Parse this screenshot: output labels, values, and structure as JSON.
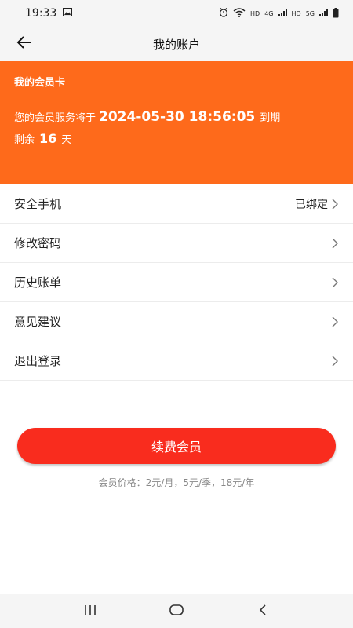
{
  "status_bar": {
    "time": "19:33",
    "network_4g": "4G",
    "network_hd1": "HD",
    "network_hd2": "HD",
    "network_5g": "5G"
  },
  "header": {
    "title": "我的账户"
  },
  "membership_card": {
    "title": "我的会员卡",
    "expiry_prefix": "您的会员服务将于",
    "expiry_date": "2024-05-30 18:56:05",
    "expiry_suffix": "到期",
    "remaining_prefix": "剩余",
    "remaining_days": "16",
    "remaining_suffix": "天"
  },
  "menu": {
    "items": [
      {
        "label": "安全手机",
        "value": "已绑定"
      },
      {
        "label": "修改密码"
      },
      {
        "label": "历史账单"
      },
      {
        "label": "意见建议"
      },
      {
        "label": "退出登录"
      }
    ]
  },
  "renew": {
    "button_label": "续费会员",
    "price_text": "会员价格：2元/月，5元/季，18元/年"
  },
  "colors": {
    "card_bg": "#fe6a1b",
    "button_bg": "#f92c1e"
  },
  "icons": {
    "back": "arrow-left-icon",
    "chevron": "chevron-right-icon",
    "nav_recents": "recents-icon",
    "nav_home": "home-icon",
    "nav_back": "back-icon"
  }
}
